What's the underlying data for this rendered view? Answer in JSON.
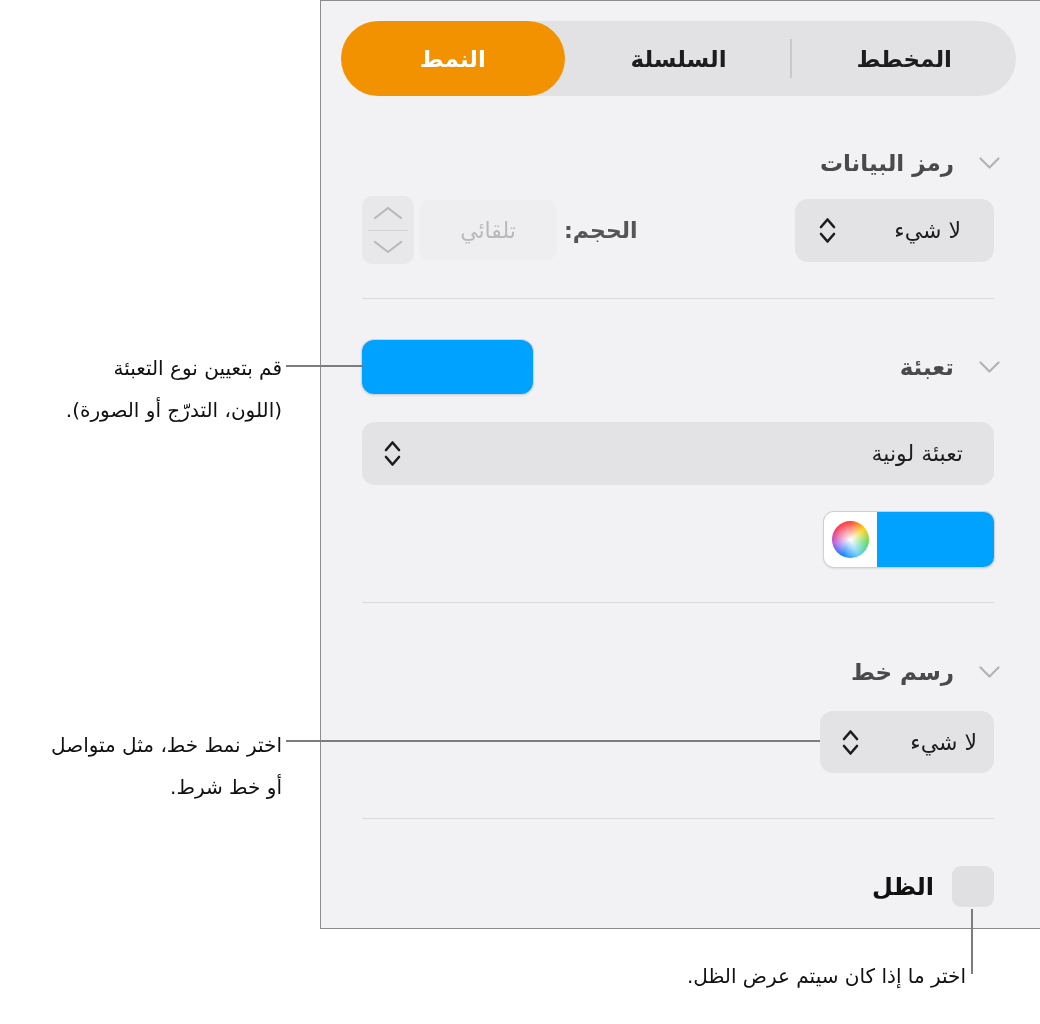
{
  "tabs": [
    {
      "label": "المخطط",
      "selected": false
    },
    {
      "label": "السلسلة",
      "selected": false
    },
    {
      "label": "النمط",
      "selected": true
    }
  ],
  "data_symbol": {
    "title": "رمز البيانات",
    "expanded": true,
    "symbol_popup": "لا شيء",
    "size_label": "الحجم:",
    "size_field": {
      "value": "تلقائي",
      "disabled": true
    }
  },
  "fill": {
    "title": "تعبئة",
    "expanded": true,
    "swatch": {
      "color": "#00a2ff"
    },
    "fill_type_popup": "تعبئة لونية",
    "color_well": {
      "color": "#00a2ff"
    }
  },
  "stroke": {
    "title": "رسم خط",
    "expanded": true,
    "style_popup": "لا شيء"
  },
  "shadow": {
    "label": "الظل",
    "checked": false
  },
  "callouts": [
    {
      "kind": "side",
      "text": "قم بتعيين نوع التعبئة\n(اللون، التدرّج أو الصورة)."
    },
    {
      "kind": "side",
      "text": "اختر نمط خط، مثل متواصل\nأو خط شرط."
    },
    {
      "kind": "below",
      "text": "اختر ما إذا كان سيتم عرض الظل."
    }
  ]
}
